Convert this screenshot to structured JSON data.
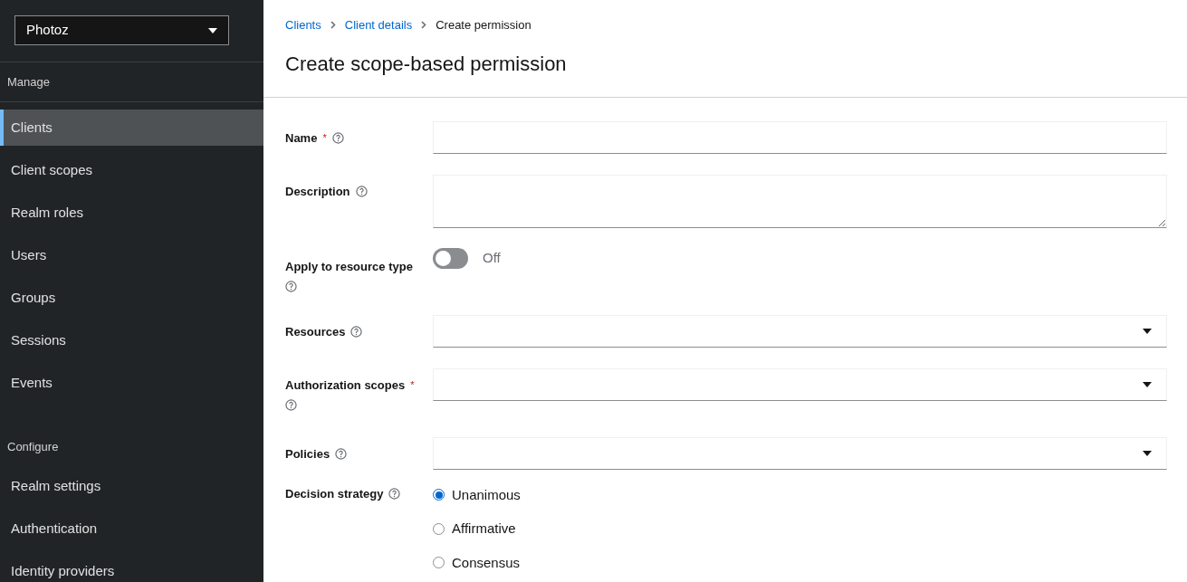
{
  "realm_selector": {
    "value": "Photoz"
  },
  "sidebar": {
    "sections": [
      {
        "heading": "Manage",
        "items": [
          {
            "label": "Clients",
            "selected": true
          },
          {
            "label": "Client scopes",
            "selected": false
          },
          {
            "label": "Realm roles",
            "selected": false
          },
          {
            "label": "Users",
            "selected": false
          },
          {
            "label": "Groups",
            "selected": false
          },
          {
            "label": "Sessions",
            "selected": false
          },
          {
            "label": "Events",
            "selected": false
          }
        ]
      },
      {
        "heading": "Configure",
        "items": [
          {
            "label": "Realm settings",
            "selected": false
          },
          {
            "label": "Authentication",
            "selected": false
          },
          {
            "label": "Identity providers",
            "selected": false
          }
        ]
      }
    ]
  },
  "breadcrumb": [
    {
      "label": "Clients",
      "link": true
    },
    {
      "label": "Client details",
      "link": true
    },
    {
      "label": "Create permission",
      "link": false
    }
  ],
  "title": "Create scope-based permission",
  "form": [
    {
      "kind": "text",
      "label": "Name",
      "required_mark": "*"
    },
    {
      "kind": "textarea",
      "label": "Description"
    },
    {
      "kind": "switch",
      "label": "Apply to resource type",
      "on": false,
      "state_label": "Off"
    },
    {
      "kind": "select",
      "label": "Resources"
    },
    {
      "kind": "select",
      "label": "Authorization scopes",
      "required_mark": "*"
    },
    {
      "kind": "select",
      "label": "Policies"
    },
    {
      "kind": "radio",
      "label": "Decision strategy",
      "options": [
        {
          "label": "Unanimous",
          "selected": true
        },
        {
          "label": "Affirmative",
          "selected": false
        },
        {
          "label": "Consensus",
          "selected": false
        }
      ]
    }
  ]
}
